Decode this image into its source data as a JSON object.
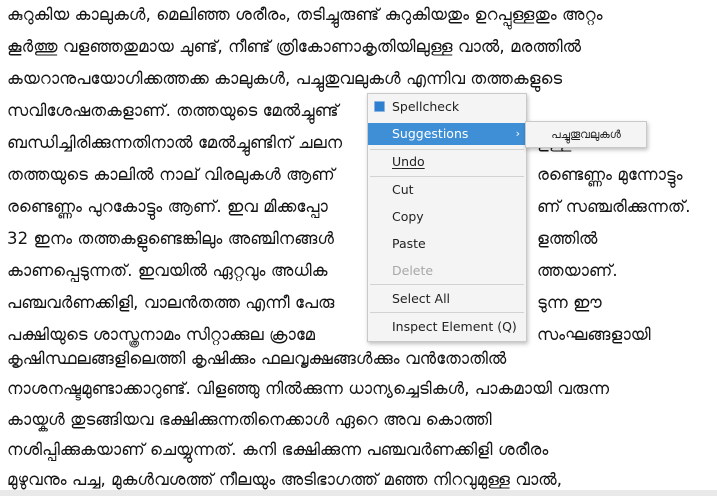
{
  "document": {
    "lines": [
      "കുറുകിയ കാലുകൾ, മെലിഞ്ഞ ശരീരം, തടിച്ചുരുണ്ട് കുറുകിയതും ഉറപ്പുള്ളതും അറ്റം",
      "കൂർത്തു വളഞ്ഞതുമായ ചുണ്ട്, നീണ്ട് ത്രികോണാകൃതിയിലുള്ള വാൽ, മരത്തിൽ",
      "കയറാനുപയോഗിക്കത്തക്ക കാലുകൾ, പച്ചുതുവലുകൾ എന്നിവ തത്തകളുടെ",
      "സവിശേഷതകളാണ്. തത്തയുടെ മേൽച്ചുണ്ട്",
      "ബന്ധിച്ചിരിക്കുന്നതിനാൽ മേൽച്ചുണ്ടിന് ചലന",
      "തത്തയുടെ കാലിൽ നാല് വിരലുകൾ ആണ്",
      "രണ്ടെണ്ണം പുറകോട്ടും ആണ്. ഇവ മിക്കപ്പോ",
      "32 ഇനം തത്തകളുണ്ടെങ്കിലും അഞ്ചിനങ്ങൾ",
      "കാണപ്പെടുന്നത്. ഇവയിൽ ഏറ്റവും അധിക",
      "പഞ്ചവർണക്കിളി, വാലൻതത്ത എന്നീ പേരു",
      "പക്ഷിയുടെ ശാസ്ത്രനാമം സിറ്റാക്കുല ക്രാമേ",
      "കൃഷിസ്ഥലങ്ങളിലെത്തി കൃഷിക്കും ഫലവൃക്ഷങ്ങൾക്കും വൻതോതിൽ",
      "നാശനഷ്ടമുണ്ടാക്കാറുണ്ട്. വിളഞ്ഞു നിൽക്കുന്ന ധാന്യച്ചെടികൾ, പാകമായി വരുന്ന",
      "കായ്കൾ തുടങ്ങിയവ ഭക്ഷിക്കുന്നതിനെക്കാൾ ഏറെ അവ കൊത്തി",
      "നശിപ്പിക്കുകയാണ് ചെയ്യുന്നത്. കനി ഭക്ഷിക്കുന്ന പഞ്ചവർണക്കിളി ശരീരം",
      "മുഴുവനും പച്ച, മുകൾവശത്ത് നീലയും അടിഭാഗത്ത് മഞ്ഞ നിറവുമുള്ള വാൽ,"
    ],
    "right_fragments": [
      {
        "line": 5,
        "text": "ളള്ള."
      },
      {
        "line": 6,
        "text": "രണ്ടെണ്ണം മുന്നോട്ടും"
      },
      {
        "line": 7,
        "text": "ണ് സഞ്ചരിക്കുന്നത്."
      },
      {
        "line": 8,
        "text": "ളത്തിൽ"
      },
      {
        "line": 9,
        "text": "ത്തയാണ്."
      },
      {
        "line": 10,
        "text": "ടുന്ന ഈ"
      },
      {
        "line": 11,
        "text": "സംഘങ്ങളായി"
      }
    ]
  },
  "context_menu": {
    "spellcheck_label": "Spellcheck",
    "spellcheck_checked": true,
    "suggestions_label": "Suggestions",
    "undo": "Undo",
    "cut": "Cut",
    "copy": "Copy",
    "paste": "Paste",
    "delete": "Delete",
    "select_all": "Select All",
    "inspect_element": "Inspect Element (Q)"
  },
  "suggestions_submenu": {
    "items": [
      "പച്ചുതൂവലുകൾ"
    ]
  },
  "colors": {
    "highlight": "#3f8fd6",
    "spell_underline": "#dd2222",
    "menu_bg": "#f4f4f4"
  }
}
